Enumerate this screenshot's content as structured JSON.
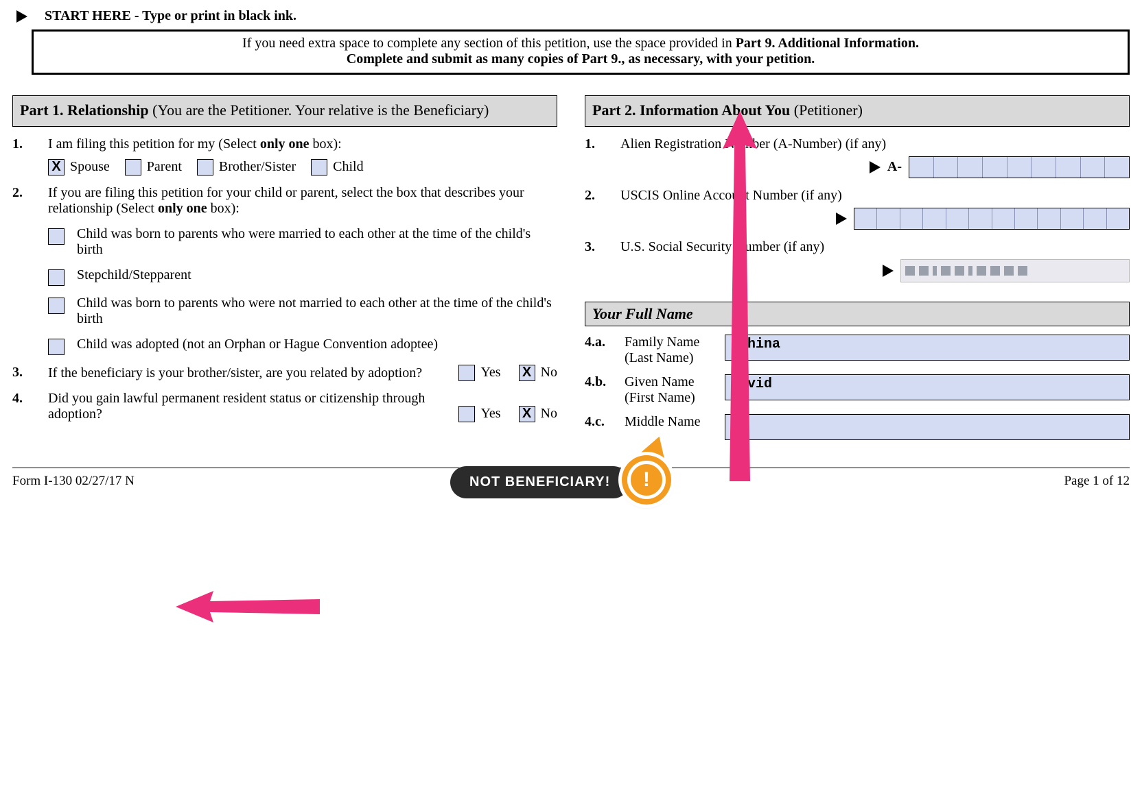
{
  "header": {
    "start_here": "START HERE - Type or print in black ink.",
    "notice_prefix": "If you need extra space to complete any section of this petition, use the space provided in ",
    "notice_bold1": "Part 9. Additional Information.",
    "notice_line2_prefix": "Complete and submit as many copies of Part 9., as necessary, with your petition."
  },
  "part1": {
    "title_bold": "Part 1.  Relationship",
    "title_rest": " (You are the Petitioner.  Your relative is the Beneficiary)",
    "q1": {
      "num": "1.",
      "text_prefix": "I am filing this petition for my (Select ",
      "text_bold": "only one",
      "text_suffix": " box):",
      "options": [
        "Spouse",
        "Parent",
        "Brother/Sister",
        "Child"
      ],
      "checked_index": 0
    },
    "q2": {
      "num": "2.",
      "text_prefix": "If you are filing this petition for your child or parent, select the box that describes your relationship (Select ",
      "text_bold": "only one",
      "text_suffix": " box):",
      "options": [
        "Child was born to parents who were married to each other at the time of the child's birth",
        "Stepchild/Stepparent",
        "Child was born to parents who were not married to each other at the time of the child's birth",
        "Child was adopted (not an Orphan or Hague Convention adoptee)"
      ]
    },
    "q3": {
      "num": "3.",
      "text": "If the beneficiary is your brother/sister, are you related by adoption?",
      "yes": "Yes",
      "no": "No",
      "answer": "No"
    },
    "q4": {
      "num": "4.",
      "text": "Did you gain lawful permanent resident status or citizenship through adoption?",
      "yes": "Yes",
      "no": "No",
      "answer": "No"
    }
  },
  "part2": {
    "title_bold": "Part 2.  Information About You",
    "title_rest": " (Petitioner)",
    "q1": {
      "num": "1.",
      "text": "Alien Registration Number (A-Number) (if any)",
      "prefix": "A-"
    },
    "q2": {
      "num": "2.",
      "text": "USCIS Online Account Number (if any)"
    },
    "q3": {
      "num": "3.",
      "text": "U.S. Social Security Number (if any)"
    },
    "full_name_header": "Your Full Name",
    "r4a": {
      "num": "4.a.",
      "label1": "Family Name",
      "label2": "(Last Name)",
      "value": "Kohina"
    },
    "r4b": {
      "num": "4.b.",
      "label1": "Given Name",
      "label2": "(First Name)",
      "value": "David"
    },
    "r4c": {
      "num": "4.c.",
      "label1": "Middle Name",
      "label2": "",
      "value": ""
    }
  },
  "annotation": {
    "callout": "NOT BENEFICIARY!"
  },
  "footer": {
    "left": "Form I-130   02/27/17   N",
    "right": "Page 1 of 12"
  }
}
